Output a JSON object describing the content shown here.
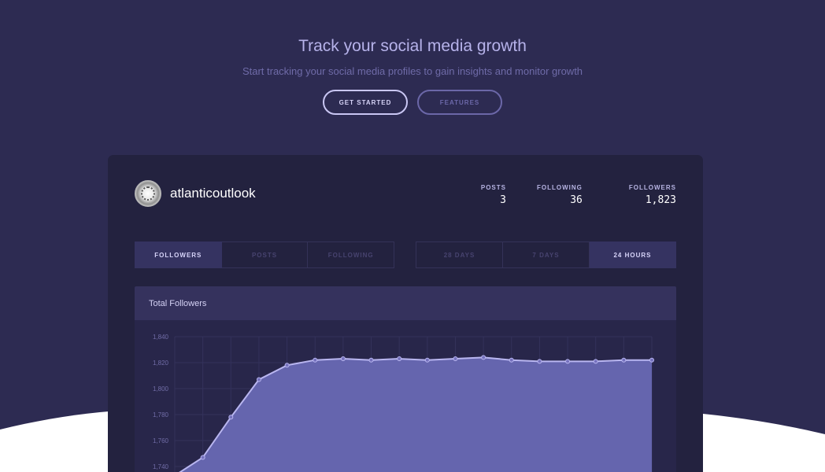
{
  "hero": {
    "title": "Track your social media growth",
    "subtitle": "Start tracking your social media profiles to gain insights and monitor growth",
    "primary_button": "GET STARTED",
    "secondary_button": "FEATURES"
  },
  "profile": {
    "username": "atlanticoutlook",
    "avatar": "profile-picture",
    "stats": {
      "posts_label": "POSTS",
      "posts": "3",
      "following_label": "FOLLOWING",
      "following": "36",
      "followers_label": "FOLLOWERS",
      "followers": "1,823"
    }
  },
  "metric_tabs": [
    "FOLLOWERS",
    "POSTS",
    "FOLLOWING"
  ],
  "metric_tabs_active": 0,
  "range_tabs": [
    "28 DAYS",
    "7 DAYS",
    "24 HOURS"
  ],
  "range_tabs_active": 2,
  "chart_panel": {
    "title": "Total Followers"
  },
  "colors": {
    "background": "#2d2b52",
    "card": "#23223f",
    "chart_fill": "#6565ae",
    "chart_line": "#b9b6f0",
    "wave": "#ffffff"
  },
  "chart_data": {
    "type": "area",
    "title": "Total Followers",
    "xlabel": "",
    "ylabel": "",
    "ylim": [
      1740,
      1840
    ],
    "y_ticks": [
      "1,840",
      "1,820",
      "1,800",
      "1,780",
      "1,760",
      "1,740"
    ],
    "x": [
      0,
      1,
      2,
      3,
      4,
      5,
      6,
      7,
      8,
      9,
      10,
      11,
      12,
      13,
      14,
      15,
      16,
      17
    ],
    "values": [
      1733,
      1747,
      1778,
      1807,
      1818,
      1822,
      1823,
      1822,
      1823,
      1822,
      1823,
      1824,
      1822,
      1821,
      1821,
      1821,
      1822,
      1822
    ]
  }
}
